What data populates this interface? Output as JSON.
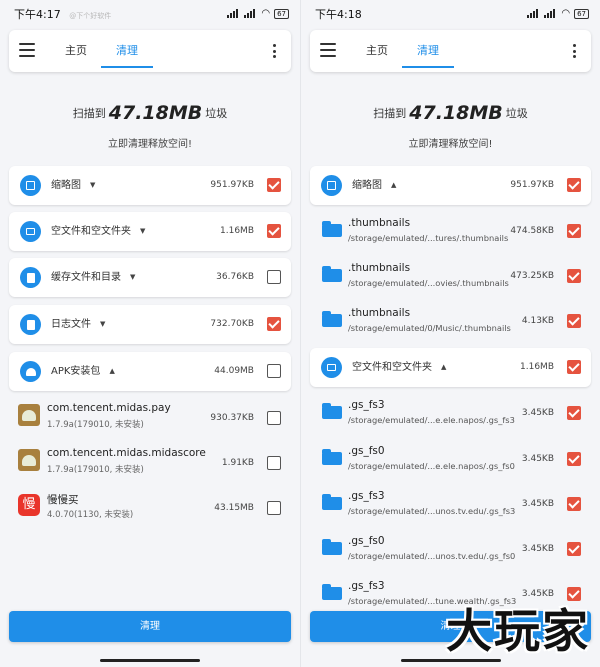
{
  "left": {
    "status": {
      "time": "下午4:17",
      "watermark": "@下个好软件",
      "battery": "67"
    },
    "tabs": {
      "home": "主页",
      "clean": "清理"
    },
    "summary": {
      "prefix": "扫描到",
      "size": "47.18MB",
      "suffix": "垃圾",
      "subtitle": "立即清理释放空间!"
    },
    "categories": [
      {
        "icon": "image-icon",
        "label": "缩略图",
        "size": "951.97KB",
        "checked": true
      },
      {
        "icon": "folder-icon",
        "label": "空文件和空文件夹",
        "size": "1.16MB",
        "checked": true
      },
      {
        "icon": "file-icon",
        "label": "缓存文件和目录",
        "size": "36.76KB",
        "checked": false
      },
      {
        "icon": "log-icon",
        "label": "日志文件",
        "size": "732.70KB",
        "checked": true
      },
      {
        "icon": "android-icon",
        "label": "APK安装包",
        "size": "44.09MB",
        "checked": false
      }
    ],
    "apks": [
      {
        "icon": "android-app-icon",
        "name": "com.tencent.midas.pay",
        "version": "1.7.9a(179010, 未安装)",
        "size": "930.37KB",
        "checked": false
      },
      {
        "icon": "android-app-icon",
        "name": "com.tencent.midas.midascore",
        "version": "1.7.9a(179010, 未安装)",
        "size": "1.91KB",
        "checked": false
      },
      {
        "icon": "manman-app-icon",
        "glyph": "慢",
        "name": "慢慢买",
        "version": "4.0.70(1130, 未安装)",
        "size": "43.15MB",
        "checked": false
      }
    ],
    "button": "清理"
  },
  "right": {
    "status": {
      "time": "下午4:18",
      "battery": "67"
    },
    "tabs": {
      "home": "主页",
      "clean": "清理"
    },
    "summary": {
      "prefix": "扫描到",
      "size": "47.18MB",
      "suffix": "垃圾",
      "subtitle": "立即清理释放空间!"
    },
    "thumb_group": {
      "label": "缩略图",
      "size": "951.97KB",
      "checked": true
    },
    "thumb_items": [
      {
        "name": ".thumbnails",
        "path": "/storage/emulated/...tures/.thumbnails",
        "size": "474.58KB",
        "checked": true
      },
      {
        "name": ".thumbnails",
        "path": "/storage/emulated/...ovies/.thumbnails",
        "size": "473.25KB",
        "checked": true
      },
      {
        "name": ".thumbnails",
        "path": "/storage/emulated/0/Music/.thumbnails",
        "size": "4.13KB",
        "checked": true
      }
    ],
    "empty_group": {
      "label": "空文件和空文件夹",
      "size": "1.16MB",
      "checked": true
    },
    "empty_items": [
      {
        "name": ".gs_fs3",
        "path": "/storage/emulated/...e.ele.napos/.gs_fs3",
        "size": "3.45KB",
        "checked": true
      },
      {
        "name": ".gs_fs0",
        "path": "/storage/emulated/...e.ele.napos/.gs_fs0",
        "size": "3.45KB",
        "checked": true
      },
      {
        "name": ".gs_fs3",
        "path": "/storage/emulated/...unos.tv.edu/.gs_fs3",
        "size": "3.45KB",
        "checked": true
      },
      {
        "name": ".gs_fs0",
        "path": "/storage/emulated/...unos.tv.edu/.gs_fs0",
        "size": "3.45KB",
        "checked": true
      },
      {
        "name": ".gs_fs3",
        "path": "/storage/emulated/...tune.wealth/.gs_fs3",
        "size": "3.45KB",
        "checked": true
      }
    ],
    "button": "清理",
    "watermark": "大玩家"
  }
}
